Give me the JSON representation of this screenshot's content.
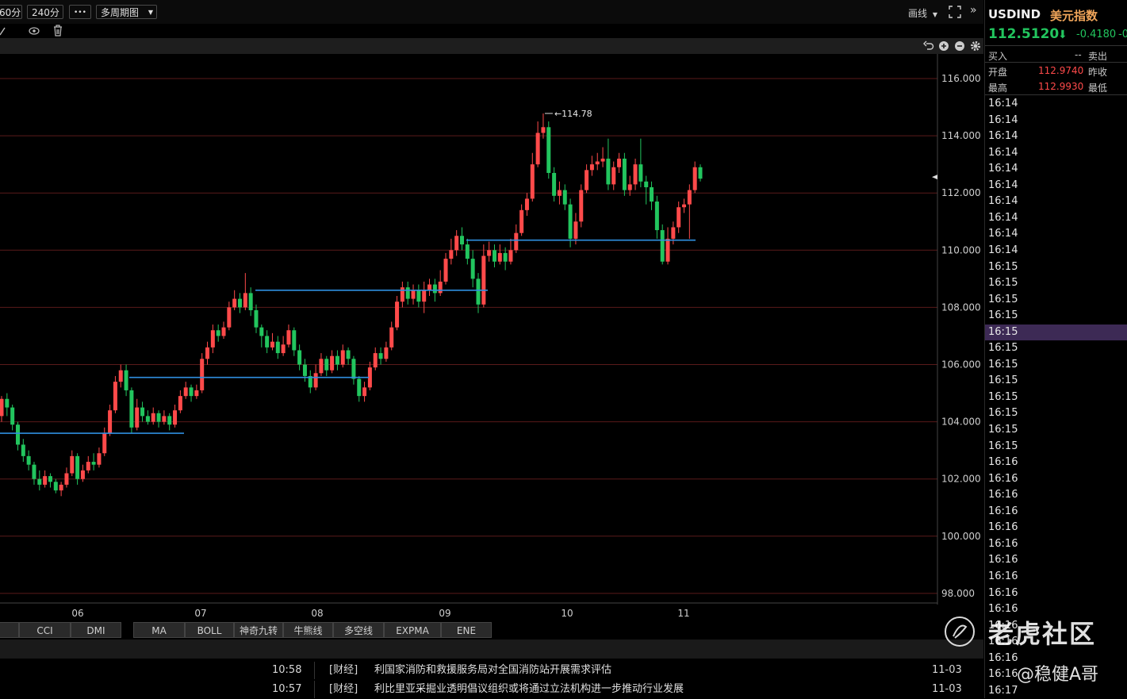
{
  "toolbar": {
    "period_partial": "60分",
    "period_240": "240分",
    "more": "•••",
    "multi_period": "多周期图",
    "draw_label": "画线",
    "expand_arrows": "»"
  },
  "right_panel": {
    "symbol": "USDIND",
    "name": "美元指数",
    "price": "112.5120",
    "change": "-0.4180",
    "change_pct_partial": "-0",
    "buy_label": "买入",
    "buy_value": "--",
    "sell_label": "卖出",
    "open_label": "开盘",
    "open_value": "112.9740",
    "prev_close_label": "昨收",
    "high_label": "最高",
    "high_value": "112.9930",
    "low_label": "最低",
    "times": [
      "16:14",
      "16:14",
      "16:14",
      "16:14",
      "16:14",
      "16:14",
      "16:14",
      "16:14",
      "16:14",
      "16:14",
      "16:15",
      "16:15",
      "16:15",
      "16:15",
      "16:15",
      "16:15",
      "16:15",
      "16:15",
      "16:15",
      "16:15",
      "16:15",
      "16:15",
      "16:16",
      "16:16",
      "16:16",
      "16:16",
      "16:16",
      "16:16",
      "16:16",
      "16:16",
      "16:16",
      "16:16",
      "16:16",
      "16:16",
      "16:16",
      "16:16",
      "16:17"
    ],
    "selected_index": 14
  },
  "indicators": [
    "CCI",
    "DMI",
    "MA",
    "BOLL",
    "神奇九转",
    "牛熊线",
    "多空线",
    "EXPMA",
    "ENE"
  ],
  "news": [
    {
      "time": "10:58",
      "tag": "[财经]",
      "title": "利国家消防和救援服务局对全国消防站开展需求评估",
      "date": "11-03"
    },
    {
      "time": "10:57",
      "tag": "[财经]",
      "title": "利比里亚采掘业透明倡议组织或将通过立法机构进一步推动行业发展",
      "date": "11-03"
    }
  ],
  "watermark": {
    "brand": "老虎社区",
    "author": "@稳健A哥"
  },
  "colors": {
    "up": "#ff4a4a",
    "down": "#22c55e",
    "grid": "#5a1a1a",
    "hline": "#2f8fe0",
    "price_green": "#22c55e",
    "value_red": "#ff4a4a"
  },
  "chart_data": {
    "type": "candlestick",
    "y_ticks": [
      "116.000",
      "114.000",
      "112.000",
      "110.000",
      "108.000",
      "106.000",
      "104.000",
      "102.000",
      "100.000",
      "98.000"
    ],
    "ylim": [
      98,
      116
    ],
    "x_labels": [
      "06",
      "07",
      "08",
      "09",
      "10",
      "11"
    ],
    "max_marker": {
      "value": 114.78,
      "label": "114.78"
    },
    "support_lines": [
      103.6,
      105.55,
      108.6,
      110.35
    ],
    "candles": [
      [
        104.2,
        104.8,
        104.9,
        104.0
      ],
      [
        104.8,
        104.5,
        105.0,
        104.2
      ],
      [
        104.5,
        103.9,
        104.6,
        103.7
      ],
      [
        103.9,
        103.2,
        104.0,
        103.0
      ],
      [
        103.2,
        102.8,
        103.4,
        102.6
      ],
      [
        102.8,
        102.5,
        103.0,
        102.3
      ],
      [
        102.5,
        102.0,
        102.6,
        101.8
      ],
      [
        102.0,
        101.8,
        102.3,
        101.6
      ],
      [
        101.8,
        102.1,
        102.3,
        101.7
      ],
      [
        102.1,
        101.9,
        102.2,
        101.7
      ],
      [
        101.9,
        101.6,
        102.0,
        101.5
      ],
      [
        101.6,
        101.8,
        101.9,
        101.4
      ],
      [
        101.8,
        102.2,
        102.4,
        101.7
      ],
      [
        102.2,
        102.8,
        103.0,
        102.1
      ],
      [
        102.8,
        102.0,
        102.9,
        101.8
      ],
      [
        102.0,
        102.3,
        102.5,
        101.9
      ],
      [
        102.3,
        102.6,
        102.8,
        102.2
      ],
      [
        102.6,
        102.5,
        102.9,
        102.3
      ],
      [
        102.5,
        102.9,
        103.1,
        102.4
      ],
      [
        102.9,
        103.6,
        103.8,
        102.8
      ],
      [
        103.6,
        104.4,
        104.6,
        103.5
      ],
      [
        104.4,
        105.4,
        105.6,
        104.3
      ],
      [
        105.4,
        105.8,
        106.0,
        105.2
      ],
      [
        105.8,
        105.1,
        106.0,
        104.9
      ],
      [
        105.1,
        103.8,
        105.2,
        103.6
      ],
      [
        103.8,
        104.5,
        104.8,
        103.7
      ],
      [
        104.5,
        104.2,
        104.7,
        104.0
      ],
      [
        104.2,
        104.0,
        104.4,
        103.9
      ],
      [
        104.0,
        104.3,
        104.5,
        103.9
      ],
      [
        104.3,
        104.0,
        104.4,
        103.8
      ],
      [
        104.0,
        104.2,
        104.4,
        103.9
      ],
      [
        104.2,
        103.9,
        104.3,
        103.7
      ],
      [
        103.9,
        104.4,
        104.6,
        103.8
      ],
      [
        104.4,
        104.9,
        105.1,
        104.3
      ],
      [
        104.9,
        105.2,
        105.4,
        104.8
      ],
      [
        105.2,
        104.9,
        105.3,
        104.7
      ],
      [
        104.9,
        105.1,
        105.3,
        104.8
      ],
      [
        105.1,
        106.2,
        106.4,
        105.0
      ],
      [
        106.2,
        106.6,
        106.8,
        106.0
      ],
      [
        106.6,
        107.2,
        107.4,
        106.4
      ],
      [
        107.2,
        107.0,
        107.4,
        106.8
      ],
      [
        107.0,
        107.3,
        107.5,
        106.9
      ],
      [
        107.3,
        108.0,
        108.2,
        107.2
      ],
      [
        108.0,
        108.3,
        108.6,
        107.9
      ],
      [
        108.3,
        108.0,
        108.5,
        107.8
      ],
      [
        108.0,
        108.5,
        109.2,
        107.9
      ],
      [
        108.5,
        107.9,
        108.7,
        107.7
      ],
      [
        107.9,
        107.3,
        108.1,
        107.1
      ],
      [
        107.3,
        107.0,
        107.4,
        106.6
      ],
      [
        107.0,
        106.6,
        107.2,
        106.4
      ],
      [
        106.6,
        106.8,
        107.1,
        106.5
      ],
      [
        106.8,
        106.4,
        107.0,
        106.2
      ],
      [
        106.4,
        106.7,
        107.0,
        106.3
      ],
      [
        106.7,
        107.2,
        107.4,
        106.6
      ],
      [
        107.2,
        106.5,
        107.3,
        106.3
      ],
      [
        106.5,
        106.0,
        106.7,
        105.8
      ],
      [
        106.0,
        105.6,
        106.2,
        105.4
      ],
      [
        105.6,
        105.2,
        105.8,
        105.0
      ],
      [
        105.2,
        105.7,
        106.0,
        105.1
      ],
      [
        105.7,
        106.2,
        106.4,
        105.6
      ],
      [
        106.2,
        105.8,
        106.3,
        105.6
      ],
      [
        105.8,
        106.3,
        106.5,
        105.7
      ],
      [
        106.3,
        106.0,
        106.5,
        105.8
      ],
      [
        106.0,
        106.5,
        106.7,
        105.9
      ],
      [
        106.5,
        106.2,
        106.6,
        106.0
      ],
      [
        106.2,
        105.5,
        106.3,
        105.3
      ],
      [
        105.5,
        104.9,
        105.6,
        104.7
      ],
      [
        104.9,
        105.2,
        105.4,
        104.7
      ],
      [
        105.2,
        105.9,
        106.1,
        105.1
      ],
      [
        105.9,
        106.4,
        106.6,
        105.8
      ],
      [
        106.4,
        106.2,
        106.6,
        106.0
      ],
      [
        106.2,
        106.6,
        106.8,
        106.1
      ],
      [
        106.6,
        107.3,
        107.5,
        106.5
      ],
      [
        107.3,
        108.2,
        108.4,
        107.2
      ],
      [
        108.2,
        108.7,
        108.9,
        108.0
      ],
      [
        108.7,
        108.3,
        108.9,
        108.1
      ],
      [
        108.3,
        108.6,
        108.8,
        108.1
      ],
      [
        108.6,
        108.2,
        108.8,
        108.0
      ],
      [
        108.2,
        108.6,
        108.9,
        107.8
      ],
      [
        108.6,
        108.8,
        109.0,
        108.4
      ],
      [
        108.8,
        108.5,
        109.0,
        108.2
      ],
      [
        108.5,
        108.9,
        109.3,
        108.4
      ],
      [
        108.9,
        109.7,
        109.9,
        108.8
      ],
      [
        109.7,
        110.0,
        110.4,
        109.5
      ],
      [
        110.0,
        110.5,
        110.7,
        109.8
      ],
      [
        110.5,
        110.2,
        110.8,
        110.0
      ],
      [
        110.2,
        109.7,
        110.4,
        109.5
      ],
      [
        109.7,
        109.0,
        110.0,
        108.7
      ],
      [
        109.0,
        108.1,
        109.2,
        107.8
      ],
      [
        108.1,
        109.8,
        110.2,
        108.0
      ],
      [
        109.8,
        110.0,
        110.3,
        109.6
      ],
      [
        110.0,
        109.6,
        110.2,
        109.4
      ],
      [
        109.6,
        109.9,
        110.2,
        109.5
      ],
      [
        109.9,
        109.6,
        110.1,
        109.3
      ],
      [
        109.6,
        110.0,
        110.4,
        109.5
      ],
      [
        110.0,
        110.6,
        110.9,
        109.9
      ],
      [
        110.6,
        111.4,
        111.6,
        110.5
      ],
      [
        111.4,
        111.8,
        112.0,
        111.2
      ],
      [
        111.8,
        113.0,
        113.4,
        111.7
      ],
      [
        113.0,
        114.1,
        114.5,
        112.9
      ],
      [
        114.1,
        114.3,
        114.78,
        113.9
      ],
      [
        114.3,
        112.7,
        114.5,
        112.5
      ],
      [
        112.7,
        111.9,
        112.9,
        111.7
      ],
      [
        111.9,
        112.1,
        112.4,
        111.6
      ],
      [
        112.1,
        111.6,
        112.3,
        111.4
      ],
      [
        111.6,
        110.4,
        111.8,
        110.1
      ],
      [
        110.4,
        111.0,
        111.3,
        110.2
      ],
      [
        111.0,
        112.1,
        112.3,
        110.8
      ],
      [
        112.1,
        112.8,
        113.0,
        112.0
      ],
      [
        112.8,
        113.0,
        113.3,
        112.6
      ],
      [
        113.0,
        113.1,
        113.4,
        112.8
      ],
      [
        113.1,
        113.2,
        113.6,
        112.9
      ],
      [
        113.2,
        112.3,
        113.9,
        112.1
      ],
      [
        112.3,
        112.9,
        113.1,
        112.1
      ],
      [
        112.9,
        113.2,
        113.4,
        112.7
      ],
      [
        113.2,
        112.1,
        113.4,
        111.9
      ],
      [
        112.1,
        112.3,
        112.6,
        111.9
      ],
      [
        112.3,
        113.0,
        113.2,
        112.1
      ],
      [
        113.0,
        112.4,
        113.9,
        112.2
      ],
      [
        112.4,
        112.2,
        112.6,
        111.6
      ],
      [
        112.2,
        111.7,
        112.4,
        111.4
      ],
      [
        111.7,
        110.7,
        111.9,
        110.4
      ],
      [
        110.7,
        109.6,
        110.9,
        109.5
      ],
      [
        109.6,
        110.4,
        110.8,
        109.5
      ],
      [
        110.4,
        110.8,
        111.0,
        110.2
      ],
      [
        110.8,
        111.5,
        111.7,
        110.6
      ],
      [
        111.5,
        111.6,
        111.8,
        111.3
      ],
      [
        111.6,
        112.1,
        112.3,
        110.4
      ],
      [
        112.1,
        112.9,
        113.1,
        112.0
      ],
      [
        112.9,
        112.5,
        113.0,
        112.4
      ]
    ]
  }
}
